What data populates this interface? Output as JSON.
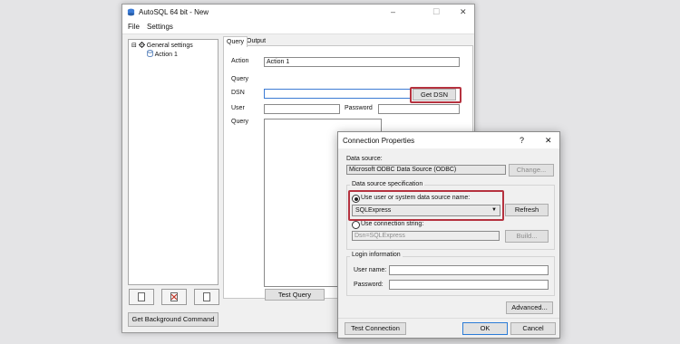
{
  "main_window": {
    "title": "AutoSQL 64 bit - New",
    "controls": {
      "minimize": "–",
      "maximize": "☐",
      "close": "✕"
    },
    "menu": [
      "File",
      "Settings"
    ],
    "tree": {
      "root": "General settings",
      "child": "Action 1",
      "expander": "⊟"
    },
    "tabs": [
      "Query",
      "Output"
    ],
    "fields": {
      "action_label": "Action",
      "action_value": "Action 1",
      "query_group_label": "Query",
      "dsn_label": "DSN",
      "dsn_value": "",
      "user_label": "User",
      "password_label": "Password",
      "query_label": "Query"
    },
    "buttons": {
      "get_dsn": "Get DSN",
      "test_query": "Test Query",
      "get_background_command": "Get Background Command"
    },
    "bottom_icons": [
      "new-document-icon",
      "delete-document-icon",
      "copy-document-icon"
    ],
    "highlight_color": "#b5323f"
  },
  "dialog": {
    "title": "Connection Properties",
    "controls": {
      "help": "?",
      "close": "✕"
    },
    "data_source_label": "Data source:",
    "data_source_value": "Microsoft ODBC Data Source (ODBC)",
    "change_button": "Change...",
    "spec_group_label": "Data source specification",
    "use_dsn_label": "Use user or system data source name:",
    "dsn_selected": "SQLExpress",
    "refresh_button": "Refresh",
    "use_connstr_label": "Use connection string:",
    "connstr_value": "Dsn=SQLExpress",
    "build_button": "Build...",
    "login_group_label": "Login information",
    "username_label": "User name:",
    "password_label": "Password:",
    "advanced_button": "Advanced...",
    "test_connection_button": "Test Connection",
    "ok_button": "OK",
    "cancel_button": "Cancel"
  }
}
